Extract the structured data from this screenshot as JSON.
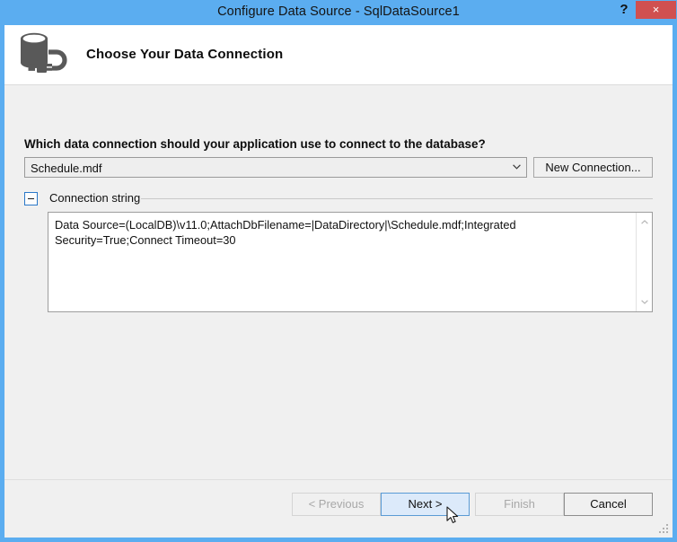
{
  "window": {
    "title": "Configure Data Source - SqlDataSource1",
    "help_label": "?",
    "close_label": "×",
    "titlebar_color": "#5badf0",
    "close_color": "#d05050"
  },
  "banner": {
    "heading": "Choose Your Data Connection",
    "icon": "database-connection-icon"
  },
  "form": {
    "prompt": "Which data connection should your application use to connect to the database?",
    "connection_combo": {
      "value": "Schedule.mdf",
      "arrow": "⌄",
      "options": [
        "Schedule.mdf"
      ]
    },
    "new_connection_button": "New Connection...",
    "group": {
      "label": "Connection string",
      "expander_state": "expanded",
      "expander_glyph": "−"
    },
    "connection_string": "Data Source=(LocalDB)\\v11.0;AttachDbFilename=|DataDirectory|\\Schedule.mdf;Integrated Security=True;Connect Timeout=30",
    "scrollbar": {
      "up_arrow": "▲",
      "down_arrow": "▼"
    }
  },
  "footer": {
    "buttons": [
      {
        "label": "< Previous",
        "state": "disabled"
      },
      {
        "label": "Next >",
        "state": "default"
      },
      {
        "label": "Finish",
        "state": "disabled"
      },
      {
        "label": "Cancel",
        "state": "normal"
      }
    ]
  }
}
